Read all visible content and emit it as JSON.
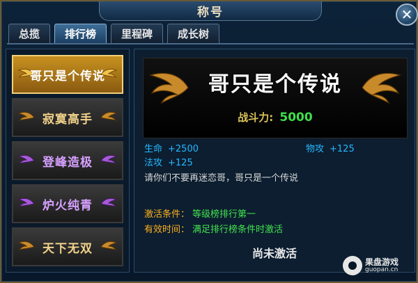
{
  "window": {
    "title": "称号",
    "close_glyph": "✕"
  },
  "tabs": [
    {
      "label": "总揽",
      "active": false
    },
    {
      "label": "排行榜",
      "active": true
    },
    {
      "label": "里程碑",
      "active": false
    },
    {
      "label": "成长树",
      "active": false
    }
  ],
  "titles": [
    {
      "label": "哥只是个传说",
      "selected": true,
      "color": "#ffffff",
      "wing_color": "#d89a2c"
    },
    {
      "label": "寂寞高手",
      "selected": false,
      "color": "#f1d28a",
      "wing_color": "#c98a2c"
    },
    {
      "label": "登峰造极",
      "selected": false,
      "color": "#d6a0ff",
      "wing_color": "#a65ad8"
    },
    {
      "label": "炉火纯青",
      "selected": false,
      "color": "#d6a0ff",
      "wing_color": "#a65ad8"
    },
    {
      "label": "天下无双",
      "selected": false,
      "color": "#f1d28a",
      "wing_color": "#c98a2c"
    }
  ],
  "detail": {
    "title": "哥只是个传说",
    "power_label": "战斗力:",
    "power_value": "5000",
    "stats": [
      {
        "key": "生命",
        "value": "+2500"
      },
      {
        "key": "物攻",
        "value": "+125"
      },
      {
        "key": "法攻",
        "value": "+125"
      }
    ],
    "description": "请你们不要再迷恋哥，哥只是一个传说",
    "activation_label": "激活条件：",
    "activation_value": "等级榜排行第一",
    "validity_label": "有效时间：",
    "validity_value": "满足排行榜条件时激活",
    "status": "尚未激活"
  },
  "watermark": {
    "cn": "果盘游戏",
    "en": "guopan.cn"
  },
  "colors": {
    "stat": "#26b8ff",
    "condition_key": "#ffb020",
    "condition_value": "#44e24e",
    "power": "#3ee04a",
    "gold": "#d89a2c"
  }
}
